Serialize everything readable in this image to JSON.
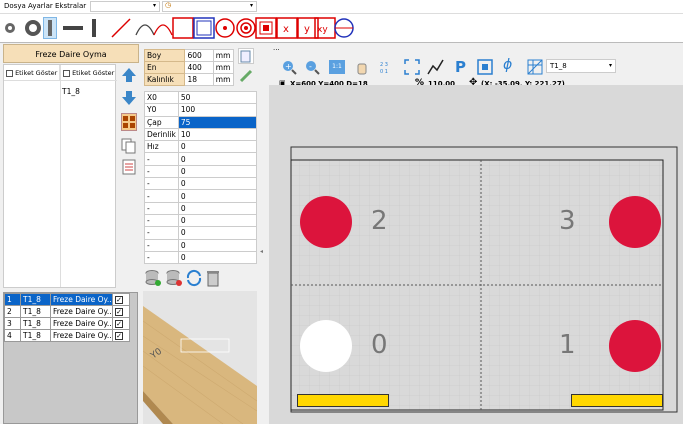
{
  "menu": {
    "file": "Dosya",
    "settings": "Ayarlar",
    "extras": "Ekstralar"
  },
  "left_panel": {
    "header": "Freze Daire Oyma",
    "col_label_1": "Etiket Göster",
    "col_label_2": "Etiket Göster",
    "tool_name": "T1_8"
  },
  "dimensions": {
    "rows": [
      {
        "label": "Boy",
        "value": "600",
        "unit": "mm"
      },
      {
        "label": "En",
        "value": "400",
        "unit": "mm"
      },
      {
        "label": "Kalınlık",
        "value": "18",
        "unit": "mm"
      }
    ]
  },
  "params": {
    "rows": [
      {
        "label": "X0",
        "value": "50"
      },
      {
        "label": "Y0",
        "value": "100"
      },
      {
        "label": "Çap",
        "value": "75"
      },
      {
        "label": "Derinlik",
        "value": "10"
      },
      {
        "label": "Hız",
        "value": "0"
      },
      {
        "label": "-",
        "value": "0"
      },
      {
        "label": "-",
        "value": "0"
      },
      {
        "label": "-",
        "value": "0"
      },
      {
        "label": "-",
        "value": "0"
      },
      {
        "label": "-",
        "value": "0"
      },
      {
        "label": "-",
        "value": "0"
      },
      {
        "label": "-",
        "value": "0"
      },
      {
        "label": "-",
        "value": "0"
      },
      {
        "label": "-",
        "value": "0"
      }
    ],
    "selected_index": 2
  },
  "jobs": [
    {
      "num": "1",
      "tool": "T1_8",
      "op": "Freze Daire Oy...",
      "checked": true
    },
    {
      "num": "2",
      "tool": "T1_8",
      "op": "Freze Daire Oy...",
      "checked": true
    },
    {
      "num": "3",
      "tool": "T1_8",
      "op": "Freze Daire Oy...",
      "checked": true
    },
    {
      "num": "4",
      "tool": "T1_8",
      "op": "Freze Daire Oy...",
      "checked": true
    }
  ],
  "preview_label": "Y0",
  "view_toolbar": {
    "tool_select": "T1_8",
    "status_dims": "X=600  Y=400  D=18",
    "zoom": "110.00",
    "coords": "(X: -35.09, Y: 221.27)",
    "tab_label": "..."
  },
  "canvas": {
    "quadrant_labels": [
      "2",
      "3",
      "0",
      "1"
    ],
    "colors": {
      "hole": "#dc143c",
      "selected_hole": "#ffffff",
      "bar": "#ffd700"
    }
  }
}
